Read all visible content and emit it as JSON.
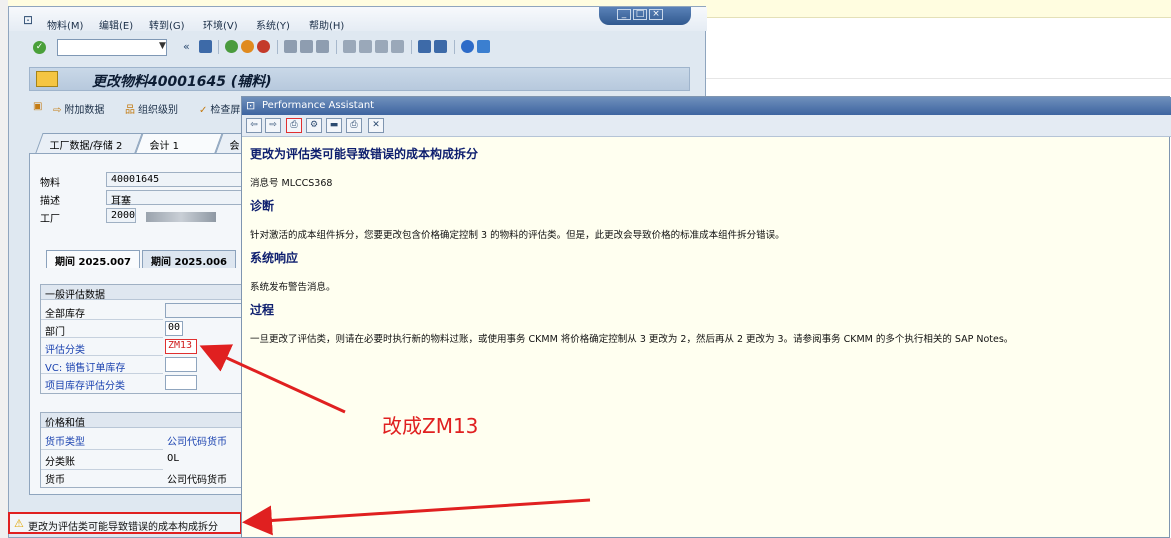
{
  "sap": {
    "menu": [
      "物料(M)",
      "编辑(E)",
      "转到(G)",
      "环境(V)",
      "系统(Y)",
      "帮助(H)"
    ],
    "title": "更改物料40001645 (辅料)",
    "app_toolbar": [
      "附加数据",
      "组织级别",
      "检查屏"
    ],
    "tabs": [
      "工厂数据/存储 2",
      "会计 1",
      "会"
    ],
    "fields": {
      "material_label": "物料",
      "material_value": "40001645",
      "desc_label": "描述",
      "desc_value": "耳塞",
      "plant_label": "工厂",
      "plant_value": "2000"
    },
    "period_tabs": [
      "期间 2025.007",
      "期间 2025.006"
    ],
    "general_group": {
      "title": "一般评估数据",
      "rows": [
        {
          "label": "全部库存",
          "value": ""
        },
        {
          "label": "部门",
          "value": "00"
        },
        {
          "label": "评估分类",
          "value": "ZM13"
        },
        {
          "label": "VC: 销售订单库存",
          "value": ""
        },
        {
          "label": "项目库存评估分类",
          "value": ""
        }
      ]
    },
    "price_group": {
      "title": "价格和值",
      "rows": [
        {
          "label": "货币类型",
          "value": "公司代码货币"
        },
        {
          "label": "分类账",
          "value": "0L"
        },
        {
          "label": "货币",
          "value": "公司代码货币"
        }
      ]
    },
    "status_text": "更改为评估类可能导致错误的成本构成拆分"
  },
  "pa": {
    "title": "Performance Assistant",
    "heading": "更改为评估类可能导致错误的成本构成拆分",
    "msg_no": "消息号 MLCCS368",
    "diag_h": "诊断",
    "diag_p": "针对激活的成本组件拆分，您要更改包含价格确定控制 3 的物料的评估类。但是，此更改会导致价格的标准成本组件拆分错误。",
    "sys_h": "系统响应",
    "sys_p": "系统发布警告消息。",
    "proc_h": "过程",
    "proc_p": "一旦更改了评估类，则请在必要时执行新的物料过账，或使用事务 CKMM 将价格确定控制从 3 更改为 2，然后再从 2 更改为 3。请参阅事务 CKMM 的多个执行相关的 SAP Notes。"
  },
  "annotation": "改成ZM13",
  "colors": {
    "annotation": "#e02020",
    "sap_bg": "#dfe8f1",
    "pa_bg": "#fffff0"
  }
}
